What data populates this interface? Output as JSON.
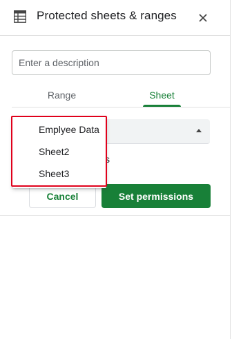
{
  "header": {
    "title": "Protected sheets & ranges",
    "icon": "sheet-grid-icon",
    "close_icon": "close-icon"
  },
  "description": {
    "placeholder": "Enter a description",
    "value": ""
  },
  "tabs": [
    {
      "label": "Range",
      "active": false
    },
    {
      "label": "Sheet",
      "active": true
    }
  ],
  "sheet_select": {
    "options": [
      "Emplyee Data",
      "Sheet2",
      "Sheet3"
    ]
  },
  "except_fragment": "s",
  "buttons": {
    "cancel": "Cancel",
    "set_permissions": "Set permissions"
  },
  "colors": {
    "accent": "#188038",
    "highlight": "#e0001b"
  }
}
